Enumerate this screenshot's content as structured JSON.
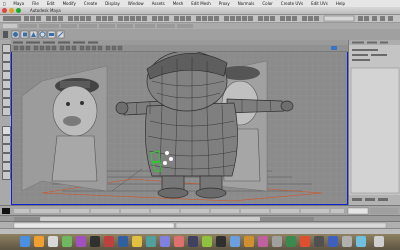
{
  "menu": {
    "app": "Maya",
    "items": [
      "File",
      "Edit",
      "Modify",
      "Create",
      "Display",
      "Window",
      "Assets",
      "Mesh",
      "Edit Mesh",
      "Proxy",
      "Normals",
      "Color",
      "Create UVs",
      "Edit UVs",
      "Help"
    ]
  },
  "window": {
    "title": "Autodesk Maya"
  },
  "colors": {
    "viewport_border": "#1020d0",
    "shape_fill": "#7f7f7f",
    "selection_green": "#23d523"
  },
  "icons": {
    "close": "red-dot",
    "minimize": "yellow-dot",
    "zoom": "green-dot"
  }
}
